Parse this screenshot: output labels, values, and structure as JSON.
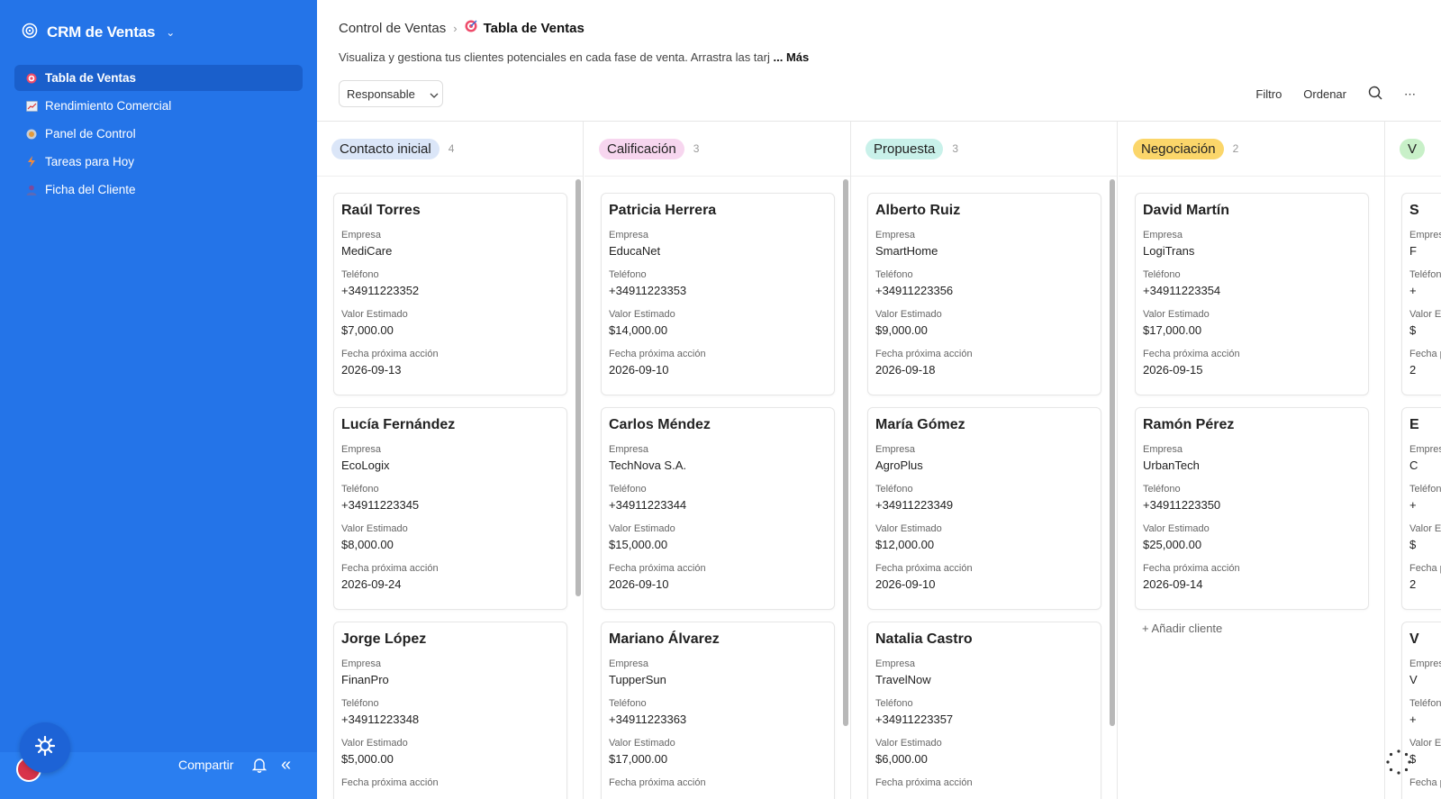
{
  "app": {
    "title": "CRM de Ventas"
  },
  "sidebar": {
    "items": [
      {
        "label": "Tabla de Ventas",
        "icon": "target-icon"
      },
      {
        "label": "Rendimiento Comercial",
        "icon": "chart-icon"
      },
      {
        "label": "Panel de Control",
        "icon": "gauge-icon"
      },
      {
        "label": "Tareas para Hoy",
        "icon": "lightning-icon"
      },
      {
        "label": "Ficha del Cliente",
        "icon": "person-icon"
      }
    ],
    "share_label": "Compartir"
  },
  "header": {
    "breadcrumb_root": "Control de Ventas",
    "breadcrumb_current": "Tabla de Ventas",
    "description": "Visualiza y gestiona tus clientes potenciales en cada fase de venta. Arrastra las tarj",
    "more_label": "... Más",
    "responsable_label": "Responsable",
    "filter_label": "Filtro",
    "sort_label": "Ordenar"
  },
  "labels": {
    "empresa": "Empresa",
    "telefono": "Teléfono",
    "valor": "Valor Estimado",
    "fecha": "Fecha próxima acción",
    "add_client": "Añadir cliente"
  },
  "columns": [
    {
      "title": "Contacto inicial",
      "count": "4",
      "color": "#dbe6f8",
      "cards": [
        {
          "name": "Raúl Torres",
          "empresa": "MediCare",
          "telefono": "+34911223352",
          "valor": "$7,000.00",
          "fecha": "2026-09-13"
        },
        {
          "name": "Lucía Fernández",
          "empresa": "EcoLogix",
          "telefono": "+34911223345",
          "valor": "$8,000.00",
          "fecha": "2026-09-24"
        },
        {
          "name": "Jorge López",
          "empresa": "FinanPro",
          "telefono": "+34911223348",
          "valor": "$5,000.00",
          "fecha": ""
        }
      ]
    },
    {
      "title": "Calificación",
      "count": "3",
      "color": "#f7d6ef",
      "cards": [
        {
          "name": "Patricia Herrera",
          "empresa": "EducaNet",
          "telefono": "+34911223353",
          "valor": "$14,000.00",
          "fecha": "2026-09-10"
        },
        {
          "name": "Carlos Méndez",
          "empresa": "TechNova S.A.",
          "telefono": "+34911223344",
          "valor": "$15,000.00",
          "fecha": "2026-09-10"
        },
        {
          "name": "Mariano Álvarez",
          "empresa": "TupperSun",
          "telefono": "+34911223363",
          "valor": "$17,000.00",
          "fecha": ""
        }
      ]
    },
    {
      "title": "Propuesta",
      "count": "3",
      "color": "#c9f1ea",
      "cards": [
        {
          "name": "Alberto Ruiz",
          "empresa": "SmartHome",
          "telefono": "+34911223356",
          "valor": "$9,000.00",
          "fecha": "2026-09-18"
        },
        {
          "name": "María Gómez",
          "empresa": "AgroPlus",
          "telefono": "+34911223349",
          "valor": "$12,000.00",
          "fecha": "2026-09-10"
        },
        {
          "name": "Natalia Castro",
          "empresa": "TravelNow",
          "telefono": "+34911223357",
          "valor": "$6,000.00",
          "fecha": ""
        }
      ]
    },
    {
      "title": "Negociación",
      "count": "2",
      "color": "#fbd66a",
      "cards": [
        {
          "name": "David Martín",
          "empresa": "LogiTrans",
          "telefono": "+34911223354",
          "valor": "$17,000.00",
          "fecha": "2026-09-15"
        },
        {
          "name": "Ramón Pérez",
          "empresa": "UrbanTech",
          "telefono": "+34911223350",
          "valor": "$25,000.00",
          "fecha": "2026-09-14"
        }
      ]
    },
    {
      "title": "V",
      "count": "",
      "color": "#c8f0c8",
      "cards": [
        {
          "name": "S",
          "empresa": "F",
          "telefono": "+",
          "valor": "$",
          "fecha": "2"
        },
        {
          "name": "E",
          "empresa": "C",
          "telefono": "+",
          "valor": "$",
          "fecha": "2"
        },
        {
          "name": "V",
          "empresa": "V",
          "telefono": "+",
          "valor": "$",
          "fecha": ""
        }
      ]
    }
  ]
}
